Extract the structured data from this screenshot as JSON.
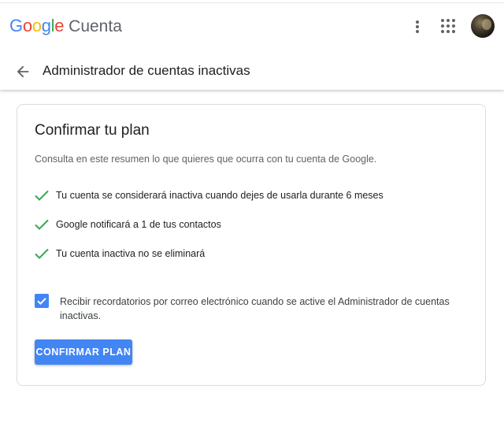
{
  "header": {
    "logo_letters": [
      {
        "char": "G",
        "color": "#4285F4"
      },
      {
        "char": "o",
        "color": "#EA4335"
      },
      {
        "char": "o",
        "color": "#FBBC05"
      },
      {
        "char": "g",
        "color": "#4285F4"
      },
      {
        "char": "l",
        "color": "#34A853"
      },
      {
        "char": "e",
        "color": "#EA4335"
      }
    ],
    "product": "Cuenta",
    "icons": [
      "more-vert-icon",
      "apps-grid-icon",
      "account-avatar"
    ]
  },
  "subbar": {
    "back_icon": "arrow-back-icon",
    "title": "Administrador de cuentas inactivas"
  },
  "card": {
    "title": "Confirmar tu plan",
    "description": "Consulta en este resumen lo que quieres que ocurra con tu cuenta de Google.",
    "items": [
      "Tu cuenta se considerará inactiva cuando dejes de usarla durante 6 meses",
      "Google notificará a 1 de tus contactos",
      "Tu cuenta inactiva no se eliminará"
    ],
    "reminder": {
      "checked": true,
      "label": "Recibir recordatorios por correo electrónico cuando se active el Administrador de cuentas inactivas."
    },
    "confirm_label": "CONFIRMAR PLAN"
  },
  "colors": {
    "accent": "#4285F4",
    "check": "#34A853"
  }
}
